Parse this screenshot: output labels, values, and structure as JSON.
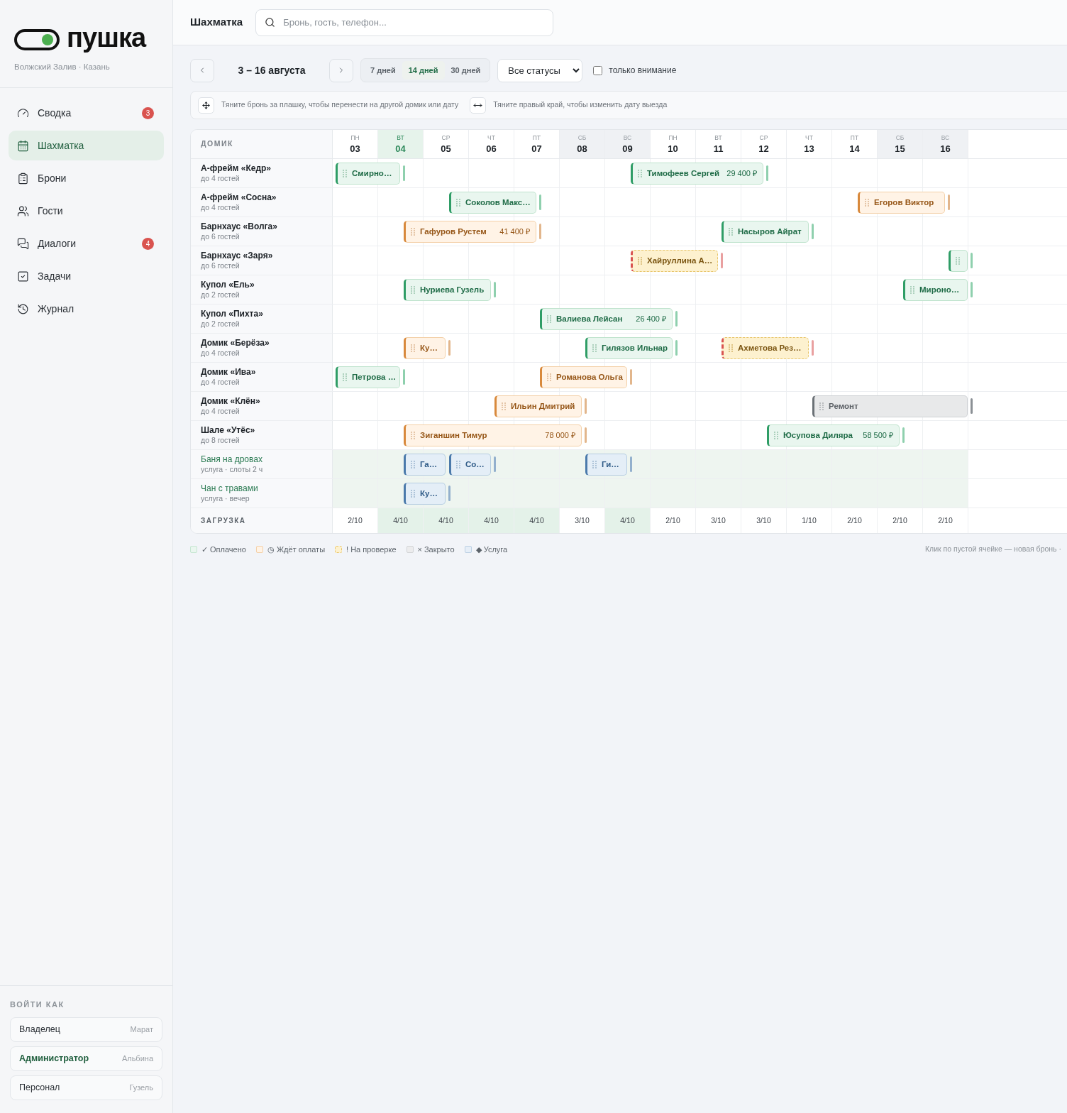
{
  "sidebar": {
    "logo": "пушка",
    "subtitle": "Волжский Залив · Казань",
    "nav": [
      {
        "label": "Сводка",
        "badge": "3",
        "selected": false
      },
      {
        "label": "Шахматка",
        "selected": true
      },
      {
        "label": "Брони",
        "selected": false
      },
      {
        "label": "Гости",
        "selected": false
      },
      {
        "label": "Диалоги",
        "badge": "4",
        "selected": false
      },
      {
        "label": "Задачи",
        "selected": false
      },
      {
        "label": "Журнал",
        "selected": false
      }
    ],
    "login_title": "ВОЙТИ КАК",
    "roles": [
      {
        "role": "Владелец",
        "person": "Марат",
        "selected": false
      },
      {
        "role": "Администратор",
        "person": "Альбина",
        "selected": true
      },
      {
        "role": "Персонал",
        "person": "Гузель",
        "selected": false
      }
    ]
  },
  "header": {
    "title": "Шахматка",
    "search": {
      "placeholder": "Бронь, гость, телефон..."
    }
  },
  "toolbar": {
    "range": "3 – 16 августа",
    "periods": [
      {
        "label": "7 дней",
        "selected": false
      },
      {
        "label": "14 дней",
        "selected": true
      },
      {
        "label": "30 дней",
        "selected": false
      }
    ],
    "status_filter": "Все статусы",
    "attention": {
      "label": "только внимание",
      "checked": false
    }
  },
  "hints": [
    "Тяните бронь за плашку, чтобы перенести на другой домик или дату",
    "Тяните правый край, чтобы изменить дату выезда"
  ],
  "grid": {
    "unit_header": "ДОМИК",
    "days": [
      {
        "weekday": "ПН",
        "date": "03",
        "today": false,
        "weekend": false
      },
      {
        "weekday": "ВТ",
        "date": "04",
        "today": true,
        "weekend": false
      },
      {
        "weekday": "СР",
        "date": "05",
        "today": false,
        "weekend": false
      },
      {
        "weekday": "ЧТ",
        "date": "06",
        "today": false,
        "weekend": false
      },
      {
        "weekday": "ПТ",
        "date": "07",
        "today": false,
        "weekend": false
      },
      {
        "weekday": "СБ",
        "date": "08",
        "today": false,
        "weekend": true
      },
      {
        "weekday": "ВС",
        "date": "09",
        "today": false,
        "weekend": true
      },
      {
        "weekday": "ПН",
        "date": "10",
        "today": false,
        "weekend": false
      },
      {
        "weekday": "ВТ",
        "date": "11",
        "today": false,
        "weekend": false
      },
      {
        "weekday": "СР",
        "date": "12",
        "today": false,
        "weekend": false
      },
      {
        "weekday": "ЧТ",
        "date": "13",
        "today": false,
        "weekend": false
      },
      {
        "weekday": "ПТ",
        "date": "14",
        "today": false,
        "weekend": false
      },
      {
        "weekday": "СБ",
        "date": "15",
        "today": false,
        "weekend": true
      },
      {
        "weekday": "ВС",
        "date": "16",
        "today": false,
        "weekend": true
      }
    ],
    "units": [
      {
        "kind": "unit",
        "name": "А-фрейм «Кедр»",
        "note": "до 4 гостей",
        "cells": [
          {
            "kind": "arrival",
            "booking": {
              "guest": "Смирно…",
              "kind": "paid",
              "from_earlier": true
            }
          },
          {
            "kind": "departure"
          },
          {
            "kind": "free"
          },
          {
            "kind": "free"
          },
          {
            "kind": "free"
          },
          {
            "kind": "free"
          },
          {
            "kind": "arrival",
            "booking": {
              "guest": "Тимофеев Сергей",
              "amount": "29 400 ₽",
              "kind": "paid",
              "from_earlier": false
            }
          },
          {
            "kind": "stay"
          },
          {
            "kind": "stay"
          },
          {
            "kind": "departure"
          },
          {
            "kind": "free"
          },
          {
            "kind": "free"
          },
          {
            "kind": "free"
          },
          {
            "kind": "free"
          }
        ]
      },
      {
        "kind": "unit",
        "name": "А-фрейм «Сосна»",
        "note": "до 4 гостей",
        "cells": [
          {
            "kind": "free"
          },
          {
            "kind": "free"
          },
          {
            "kind": "arrival",
            "booking": {
              "guest": "Соколов Макс…",
              "kind": "paid",
              "from_earlier": false
            }
          },
          {
            "kind": "stay"
          },
          {
            "kind": "departure"
          },
          {
            "kind": "free"
          },
          {
            "kind": "free"
          },
          {
            "kind": "free"
          },
          {
            "kind": "free"
          },
          {
            "kind": "free"
          },
          {
            "kind": "free"
          },
          {
            "kind": "arrival",
            "booking": {
              "guest": "Егоров Виктор",
              "kind": "pending",
              "from_earlier": false
            }
          },
          {
            "kind": "stay"
          },
          {
            "kind": "departure"
          }
        ]
      },
      {
        "kind": "unit",
        "name": "Барнхаус «Волга»",
        "note": "до 6 гостей",
        "cells": [
          {
            "kind": "free"
          },
          {
            "kind": "arrival",
            "booking": {
              "guest": "Гафуров Рустем",
              "amount": "41 400 ₽",
              "kind": "pending",
              "from_earlier": false
            }
          },
          {
            "kind": "stay"
          },
          {
            "kind": "stay"
          },
          {
            "kind": "departure"
          },
          {
            "kind": "free"
          },
          {
            "kind": "free"
          },
          {
            "kind": "free"
          },
          {
            "kind": "arrival",
            "booking": {
              "guest": "Насыров Айрат",
              "kind": "paid",
              "from_earlier": false
            }
          },
          {
            "kind": "stay"
          },
          {
            "kind": "departure"
          },
          {
            "kind": "free"
          },
          {
            "kind": "free"
          },
          {
            "kind": "free"
          }
        ]
      },
      {
        "kind": "unit",
        "name": "Барнхаус «Заря»",
        "note": "до 6 гостей",
        "cells": [
          {
            "kind": "free"
          },
          {
            "kind": "free"
          },
          {
            "kind": "free"
          },
          {
            "kind": "free"
          },
          {
            "kind": "free"
          },
          {
            "kind": "free"
          },
          {
            "kind": "arrival",
            "booking": {
              "guest": "Хайруллина А…",
              "kind": "review",
              "from_earlier": false
            }
          },
          {
            "kind": "stay"
          },
          {
            "kind": "departure"
          },
          {
            "kind": "free"
          },
          {
            "kind": "free"
          },
          {
            "kind": "free"
          },
          {
            "kind": "free"
          },
          {
            "kind": "arrival",
            "booking": {
              "kind": "paid",
              "from_earlier": false
            }
          }
        ]
      },
      {
        "kind": "unit",
        "name": "Купол «Ель»",
        "note": "до 2 гостей",
        "cells": [
          {
            "kind": "free"
          },
          {
            "kind": "arrival",
            "booking": {
              "guest": "Нуриева Гузель",
              "kind": "paid",
              "from_earlier": false
            }
          },
          {
            "kind": "stay"
          },
          {
            "kind": "departure"
          },
          {
            "kind": "free"
          },
          {
            "kind": "free"
          },
          {
            "kind": "free"
          },
          {
            "kind": "free"
          },
          {
            "kind": "free"
          },
          {
            "kind": "free"
          },
          {
            "kind": "free"
          },
          {
            "kind": "free"
          },
          {
            "kind": "arrival",
            "booking": {
              "guest": "Мироно…",
              "kind": "paid",
              "from_earlier": false
            }
          },
          {
            "kind": "stay"
          }
        ]
      },
      {
        "kind": "unit",
        "name": "Купол «Пихта»",
        "note": "до 2 гостей",
        "cells": [
          {
            "kind": "free"
          },
          {
            "kind": "free"
          },
          {
            "kind": "free"
          },
          {
            "kind": "free"
          },
          {
            "kind": "arrival",
            "booking": {
              "guest": "Валиева Лейсан",
              "amount": "26 400 ₽",
              "kind": "paid",
              "from_earlier": false
            }
          },
          {
            "kind": "stay"
          },
          {
            "kind": "stay"
          },
          {
            "kind": "departure"
          },
          {
            "kind": "free"
          },
          {
            "kind": "free"
          },
          {
            "kind": "free"
          },
          {
            "kind": "free"
          },
          {
            "kind": "free"
          },
          {
            "kind": "free"
          }
        ]
      },
      {
        "kind": "unit",
        "name": "Домик «Берёза»",
        "note": "до 4 гостей",
        "cells": [
          {
            "kind": "free"
          },
          {
            "kind": "arrival",
            "booking": {
              "guest": "Ку…",
              "kind": "pending",
              "from_earlier": false
            }
          },
          {
            "kind": "departure"
          },
          {
            "kind": "free"
          },
          {
            "kind": "free"
          },
          {
            "kind": "arrival",
            "booking": {
              "guest": "Гилязов Ильнар",
              "kind": "paid",
              "from_earlier": false
            }
          },
          {
            "kind": "stay"
          },
          {
            "kind": "departure"
          },
          {
            "kind": "arrival",
            "booking": {
              "guest": "Ахметова Рез…",
              "kind": "review",
              "from_earlier": false
            }
          },
          {
            "kind": "stay"
          },
          {
            "kind": "departure"
          },
          {
            "kind": "free"
          },
          {
            "kind": "free"
          },
          {
            "kind": "free"
          }
        ]
      },
      {
        "kind": "unit",
        "name": "Домик «Ива»",
        "note": "до 4 гостей",
        "cells": [
          {
            "kind": "arrival",
            "booking": {
              "guest": "Петрова …",
              "kind": "paid",
              "from_earlier": true
            }
          },
          {
            "kind": "departure"
          },
          {
            "kind": "free"
          },
          {
            "kind": "free"
          },
          {
            "kind": "arrival",
            "booking": {
              "guest": "Романова Ольга",
              "kind": "pending",
              "from_earlier": false
            }
          },
          {
            "kind": "stay"
          },
          {
            "kind": "departure"
          },
          {
            "kind": "free"
          },
          {
            "kind": "free"
          },
          {
            "kind": "free"
          },
          {
            "kind": "free"
          },
          {
            "kind": "free"
          },
          {
            "kind": "free"
          },
          {
            "kind": "free"
          }
        ]
      },
      {
        "kind": "unit",
        "name": "Домик «Клён»",
        "note": "до 4 гостей",
        "cells": [
          {
            "kind": "free"
          },
          {
            "kind": "free"
          },
          {
            "kind": "free"
          },
          {
            "kind": "arrival",
            "booking": {
              "guest": "Ильин Дмитрий",
              "kind": "pending",
              "from_earlier": false
            }
          },
          {
            "kind": "stay"
          },
          {
            "kind": "departure"
          },
          {
            "kind": "free"
          },
          {
            "kind": "free"
          },
          {
            "kind": "free"
          },
          {
            "kind": "free"
          },
          {
            "kind": "arrival",
            "booking": {
              "guest": "Ремонт",
              "kind": "closed",
              "from_earlier": false
            }
          },
          {
            "kind": "stay"
          },
          {
            "kind": "stay"
          },
          {
            "kind": "stay"
          }
        ]
      },
      {
        "kind": "unit",
        "name": "Шале «Утёс»",
        "note": "до 8 гостей",
        "cells": [
          {
            "kind": "free"
          },
          {
            "kind": "arrival",
            "booking": {
              "guest": "Зиганшин Тимур",
              "amount": "78 000 ₽",
              "kind": "pending",
              "from_earlier": false
            }
          },
          {
            "kind": "stay"
          },
          {
            "kind": "stay"
          },
          {
            "kind": "stay"
          },
          {
            "kind": "departure"
          },
          {
            "kind": "free"
          },
          {
            "kind": "free"
          },
          {
            "kind": "free"
          },
          {
            "kind": "arrival",
            "booking": {
              "guest": "Юсупова Диляра",
              "amount": "58 500 ₽",
              "kind": "paid",
              "from_earlier": false
            }
          },
          {
            "kind": "stay"
          },
          {
            "kind": "stay"
          },
          {
            "kind": "departure"
          },
          {
            "kind": "free"
          }
        ]
      },
      {
        "kind": "service",
        "name": "Баня на дровах",
        "note": "услуга · слоты 2 ч",
        "cells": [
          {
            "kind": "free"
          },
          {
            "kind": "arrival",
            "booking": {
              "guest": "Га…",
              "kind": "service",
              "from_earlier": false
            }
          },
          {
            "kind": "turnover",
            "booking": {
              "guest": "Со…",
              "kind": "service",
              "from_earlier": false
            }
          },
          {
            "kind": "departure"
          },
          {
            "kind": "free"
          },
          {
            "kind": "arrival",
            "booking": {
              "guest": "Ги…",
              "kind": "service",
              "from_earlier": false
            }
          },
          {
            "kind": "departure"
          },
          {
            "kind": "free"
          },
          {
            "kind": "free"
          },
          {
            "kind": "free"
          },
          {
            "kind": "free"
          },
          {
            "kind": "free"
          },
          {
            "kind": "free"
          },
          {
            "kind": "free"
          }
        ]
      },
      {
        "kind": "service",
        "name": "Чан с травами",
        "note": "услуга · вечер",
        "cells": [
          {
            "kind": "free"
          },
          {
            "kind": "arrival",
            "booking": {
              "guest": "Ку…",
              "kind": "service",
              "from_earlier": false
            }
          },
          {
            "kind": "departure"
          },
          {
            "kind": "free"
          },
          {
            "kind": "free"
          },
          {
            "kind": "free"
          },
          {
            "kind": "free"
          },
          {
            "kind": "free"
          },
          {
            "kind": "free"
          },
          {
            "kind": "free"
          },
          {
            "kind": "free"
          },
          {
            "kind": "free"
          },
          {
            "kind": "free"
          },
          {
            "kind": "free"
          }
        ]
      }
    ],
    "load_label": "ЗАГРУЗКА",
    "loads": [
      {
        "value": "2/10",
        "high": false
      },
      {
        "value": "4/10",
        "high": true
      },
      {
        "value": "4/10",
        "high": true
      },
      {
        "value": "4/10",
        "high": true
      },
      {
        "value": "4/10",
        "high": true
      },
      {
        "value": "3/10",
        "high": false
      },
      {
        "value": "4/10",
        "high": true
      },
      {
        "value": "2/10",
        "high": false
      },
      {
        "value": "3/10",
        "high": false
      },
      {
        "value": "3/10",
        "high": false
      },
      {
        "value": "1/10",
        "high": false
      },
      {
        "value": "2/10",
        "high": false
      },
      {
        "value": "2/10",
        "high": false
      },
      {
        "value": "2/10",
        "high": false
      }
    ]
  },
  "legend": [
    {
      "label": "✓ Оплачено",
      "kind": "paid"
    },
    {
      "label": "◷ Ждёт оплаты",
      "kind": "pending"
    },
    {
      "label": "! На проверке",
      "kind": "review"
    },
    {
      "label": "× Закрыто",
      "kind": "closed"
    },
    {
      "label": "◆ Услуга",
      "kind": "service"
    }
  ],
  "footer_note": "Клик по пустой ячейке — новая бронь ·"
}
